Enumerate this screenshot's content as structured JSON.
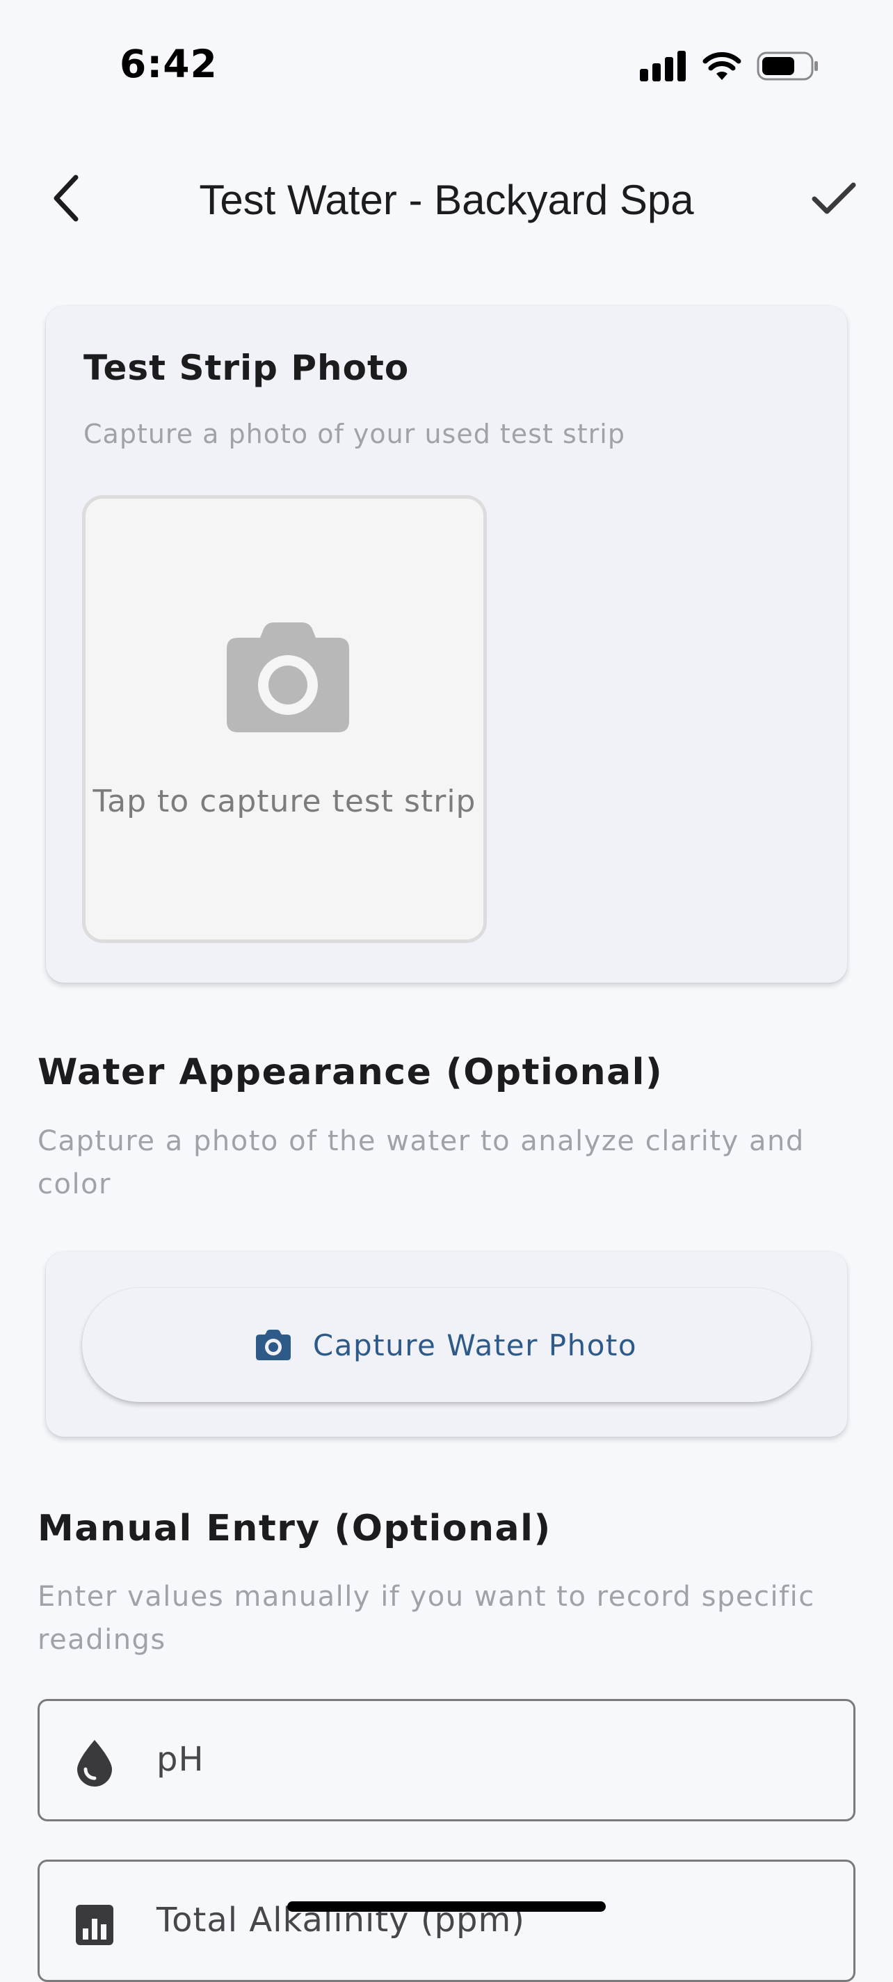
{
  "status_bar": {
    "time": "6:42"
  },
  "nav": {
    "title": "Test Water - Backyard Spa",
    "back_icon": "chevron-left-icon",
    "save_icon": "checkmark-icon"
  },
  "test_strip": {
    "title": "Test Strip Photo",
    "subtitle": "Capture a photo of your used test strip",
    "capture_label": "Tap to capture test strip",
    "icon": "camera-icon"
  },
  "water_appearance": {
    "title": "Water Appearance (Optional)",
    "description": "Capture a photo of the water to analyze clarity and color",
    "button_label": "Capture Water Photo",
    "icon": "camera-icon"
  },
  "manual_entry": {
    "title": "Manual Entry (Optional)",
    "description": "Enter values manually if you want to record specific readings",
    "fields": [
      {
        "label": "pH",
        "icon": "water-drop-icon"
      },
      {
        "label": "Total Alkalinity (ppm)",
        "icon": "bar-chart-icon"
      }
    ]
  },
  "colors": {
    "background": "#f7f8fc",
    "card": "#f1f2f8",
    "accent": "#2d5a88",
    "secondary_text": "#a1a2a7"
  }
}
